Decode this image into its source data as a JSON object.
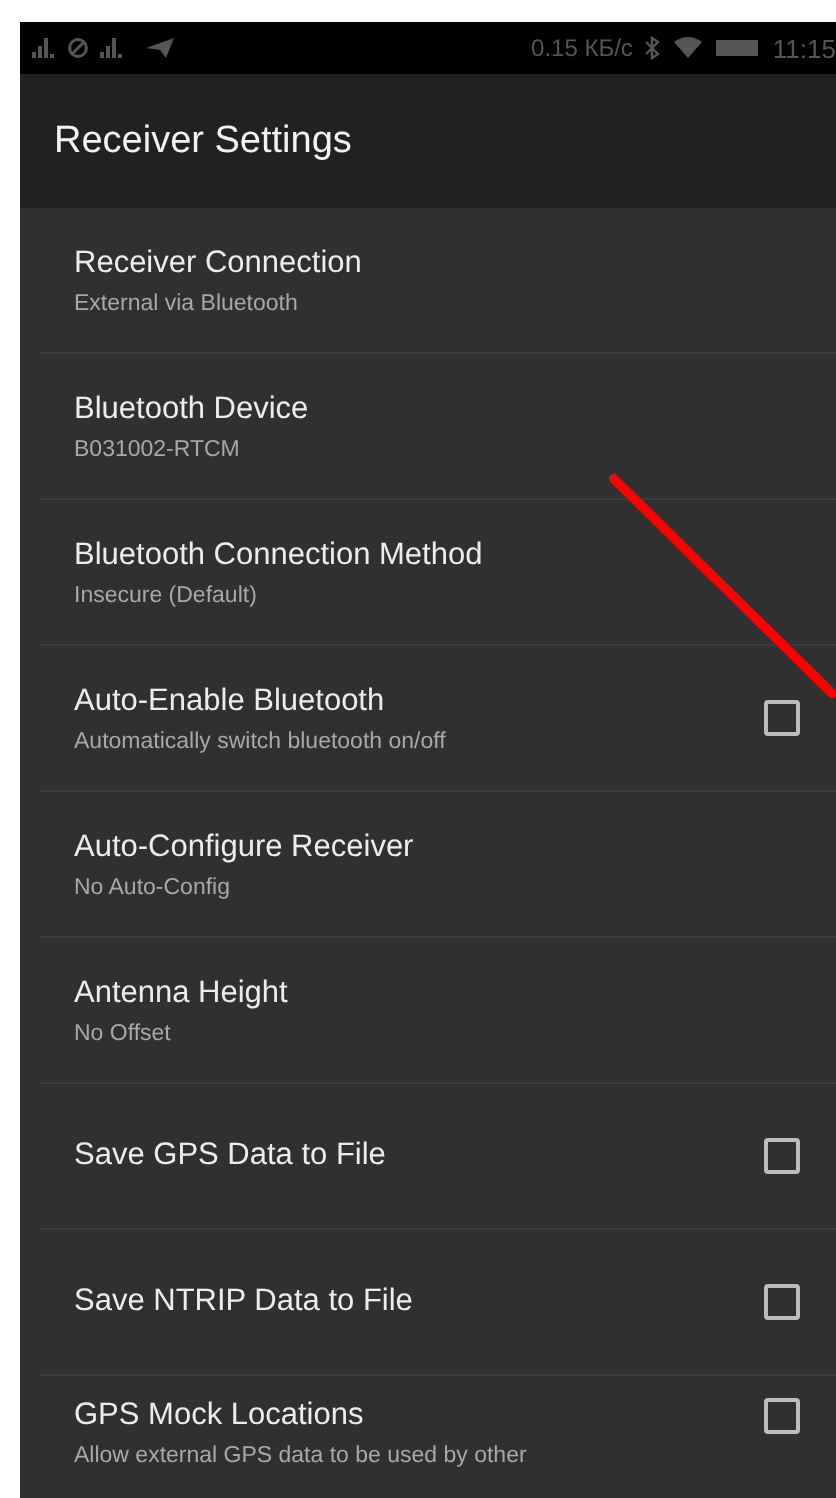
{
  "status_bar": {
    "speed": "0.15 КБ/с",
    "time": "11:15"
  },
  "header": {
    "title": "Receiver Settings"
  },
  "settings": [
    {
      "title": "Receiver Connection",
      "summary": "External via Bluetooth",
      "kind": "plain"
    },
    {
      "title": "Bluetooth Device",
      "summary": "B031002-RTCM",
      "kind": "plain"
    },
    {
      "title": "Bluetooth Connection Method",
      "summary": "Insecure (Default)",
      "kind": "plain"
    },
    {
      "title": "Auto-Enable Bluetooth",
      "summary": "Automatically switch bluetooth on/off",
      "kind": "checkbox",
      "checked": false
    },
    {
      "title": "Auto-Configure Receiver",
      "summary": "No Auto-Config",
      "kind": "plain"
    },
    {
      "title": "Antenna Height",
      "summary": "No Offset",
      "kind": "plain"
    },
    {
      "title": "Save GPS Data to File",
      "kind": "checkbox",
      "checked": false
    },
    {
      "title": "Save NTRIP Data to File",
      "kind": "checkbox",
      "checked": false
    },
    {
      "title": "GPS Mock Locations",
      "summary": "Allow external GPS data to be used by other",
      "kind": "checkbox",
      "checked": false
    }
  ]
}
